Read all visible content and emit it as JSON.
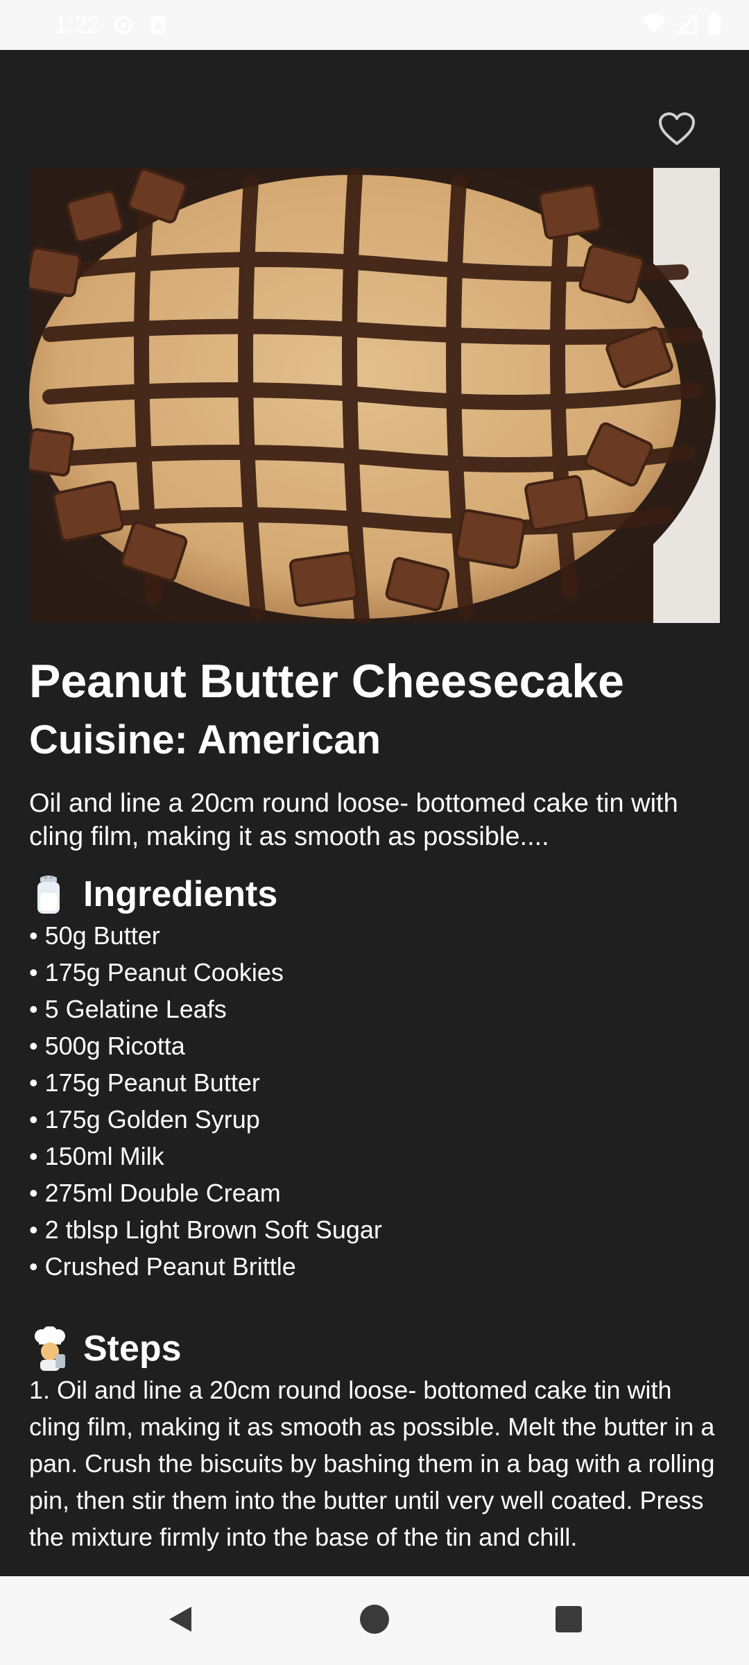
{
  "status_bar": {
    "time": "1:22"
  },
  "recipe": {
    "title": "Peanut Butter Cheesecake",
    "cuisine": "Cuisine: American",
    "summary": "Oil and line a 20cm round loose- bottomed cake tin with cling film, making it as smooth as possible....",
    "ingredients_heading": "Ingredients",
    "ingredients": [
      "• 50g Butter",
      "• 175g Peanut Cookies",
      "• 5 Gelatine Leafs",
      "• 500g Ricotta",
      "• 175g Peanut Butter",
      "• 175g Golden Syrup",
      "• 150ml Milk",
      "• 275ml Double Cream",
      "• 2 tblsp Light Brown Soft Sugar",
      "• Crushed Peanut Brittle"
    ],
    "steps_heading": "Steps",
    "steps_text": "1. Oil and line a 20cm round loose- bottomed cake tin with cling film, making it as smooth as possible. Melt the butter in a pan. Crush the biscuits by bashing them in a bag with a rolling pin, then stir them into the butter until very well coated. Press the mixture firmly into the base of the tin and chill."
  },
  "icons": {
    "favorite": "heart-outline-icon",
    "ingredients": "salt-shaker-icon",
    "steps": "chef-icon",
    "nav_back": "triangle-back-icon",
    "nav_home": "circle-home-icon",
    "nav_recents": "square-recents-icon"
  },
  "colors": {
    "background": "#1f1f20",
    "system_bars": "#f7f7f8",
    "text": "#ffffff",
    "nav_icons": "#3a3a3a"
  }
}
